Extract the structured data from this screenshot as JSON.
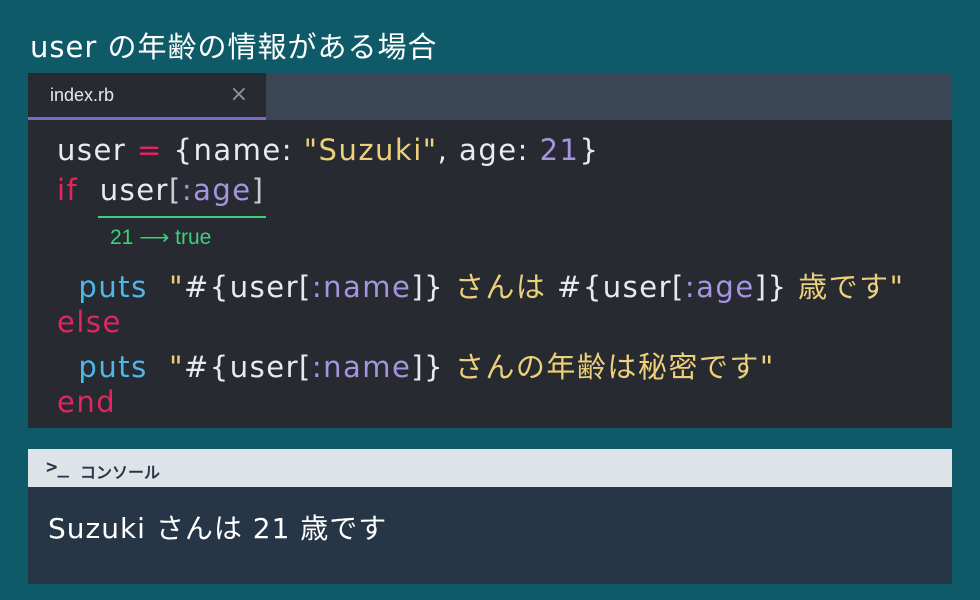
{
  "page": {
    "title": "user の年齢の情報がある場合"
  },
  "editor": {
    "tab_filename": "index.rb",
    "tab_close_icon": "close-icon",
    "code_lines": [
      {
        "tokens": [
          {
            "text": "user ",
            "kind": "plain"
          },
          {
            "text": "=",
            "kind": "kw"
          },
          {
            "text": " {name: ",
            "kind": "plain"
          },
          {
            "text": "\"Suzuki\"",
            "kind": "str"
          },
          {
            "text": ", age: ",
            "kind": "plain"
          },
          {
            "text": "21",
            "kind": "num"
          },
          {
            "text": "}",
            "kind": "plain"
          }
        ]
      },
      {
        "tokens": [
          {
            "text": "if",
            "kind": "kw"
          },
          {
            "text": "  user",
            "kind": "plain"
          },
          {
            "text": "[",
            "kind": "punct"
          },
          {
            "text": ":age",
            "kind": "sym"
          },
          {
            "text": "]",
            "kind": "punct"
          }
        ]
      },
      {
        "tokens": [
          {
            "text": "  puts",
            "kind": "fn"
          },
          {
            "text": "  \"",
            "kind": "str"
          },
          {
            "text": "#{user[",
            "kind": "plain"
          },
          {
            "text": ":name",
            "kind": "sym"
          },
          {
            "text": "]}",
            "kind": "plain"
          },
          {
            "text": " さんは ",
            "kind": "str"
          },
          {
            "text": "#{user[",
            "kind": "plain"
          },
          {
            "text": ":age",
            "kind": "sym"
          },
          {
            "text": "]}",
            "kind": "plain"
          },
          {
            "text": " 歳です\"",
            "kind": "str"
          }
        ]
      },
      {
        "tokens": [
          {
            "text": "else",
            "kind": "kw"
          }
        ]
      },
      {
        "tokens": [
          {
            "text": "  puts",
            "kind": "fn"
          },
          {
            "text": "  \"",
            "kind": "str"
          },
          {
            "text": "#{user[",
            "kind": "plain"
          },
          {
            "text": ":name",
            "kind": "sym"
          },
          {
            "text": "]}",
            "kind": "plain"
          },
          {
            "text": " さんの年齢は秘密です\"",
            "kind": "str"
          }
        ]
      },
      {
        "tokens": [
          {
            "text": "end",
            "kind": "kw"
          }
        ]
      }
    ],
    "annotation": {
      "value": "21",
      "arrow": "⟶",
      "result": "true"
    }
  },
  "console": {
    "prompt_icon": "terminal-prompt-icon",
    "prompt_glyph": ">_",
    "label": "コンソール",
    "output": "Suzuki さんは 21 歳です"
  },
  "colors": {
    "background": "#0e5a68",
    "editor_bg": "#272a31",
    "keyword": "#e3245e",
    "method": "#4fb6e6",
    "symbol": "#a794e0",
    "string": "#ecd17a",
    "annotation": "#3fd07b",
    "tab_accent": "#7b6bc7"
  }
}
